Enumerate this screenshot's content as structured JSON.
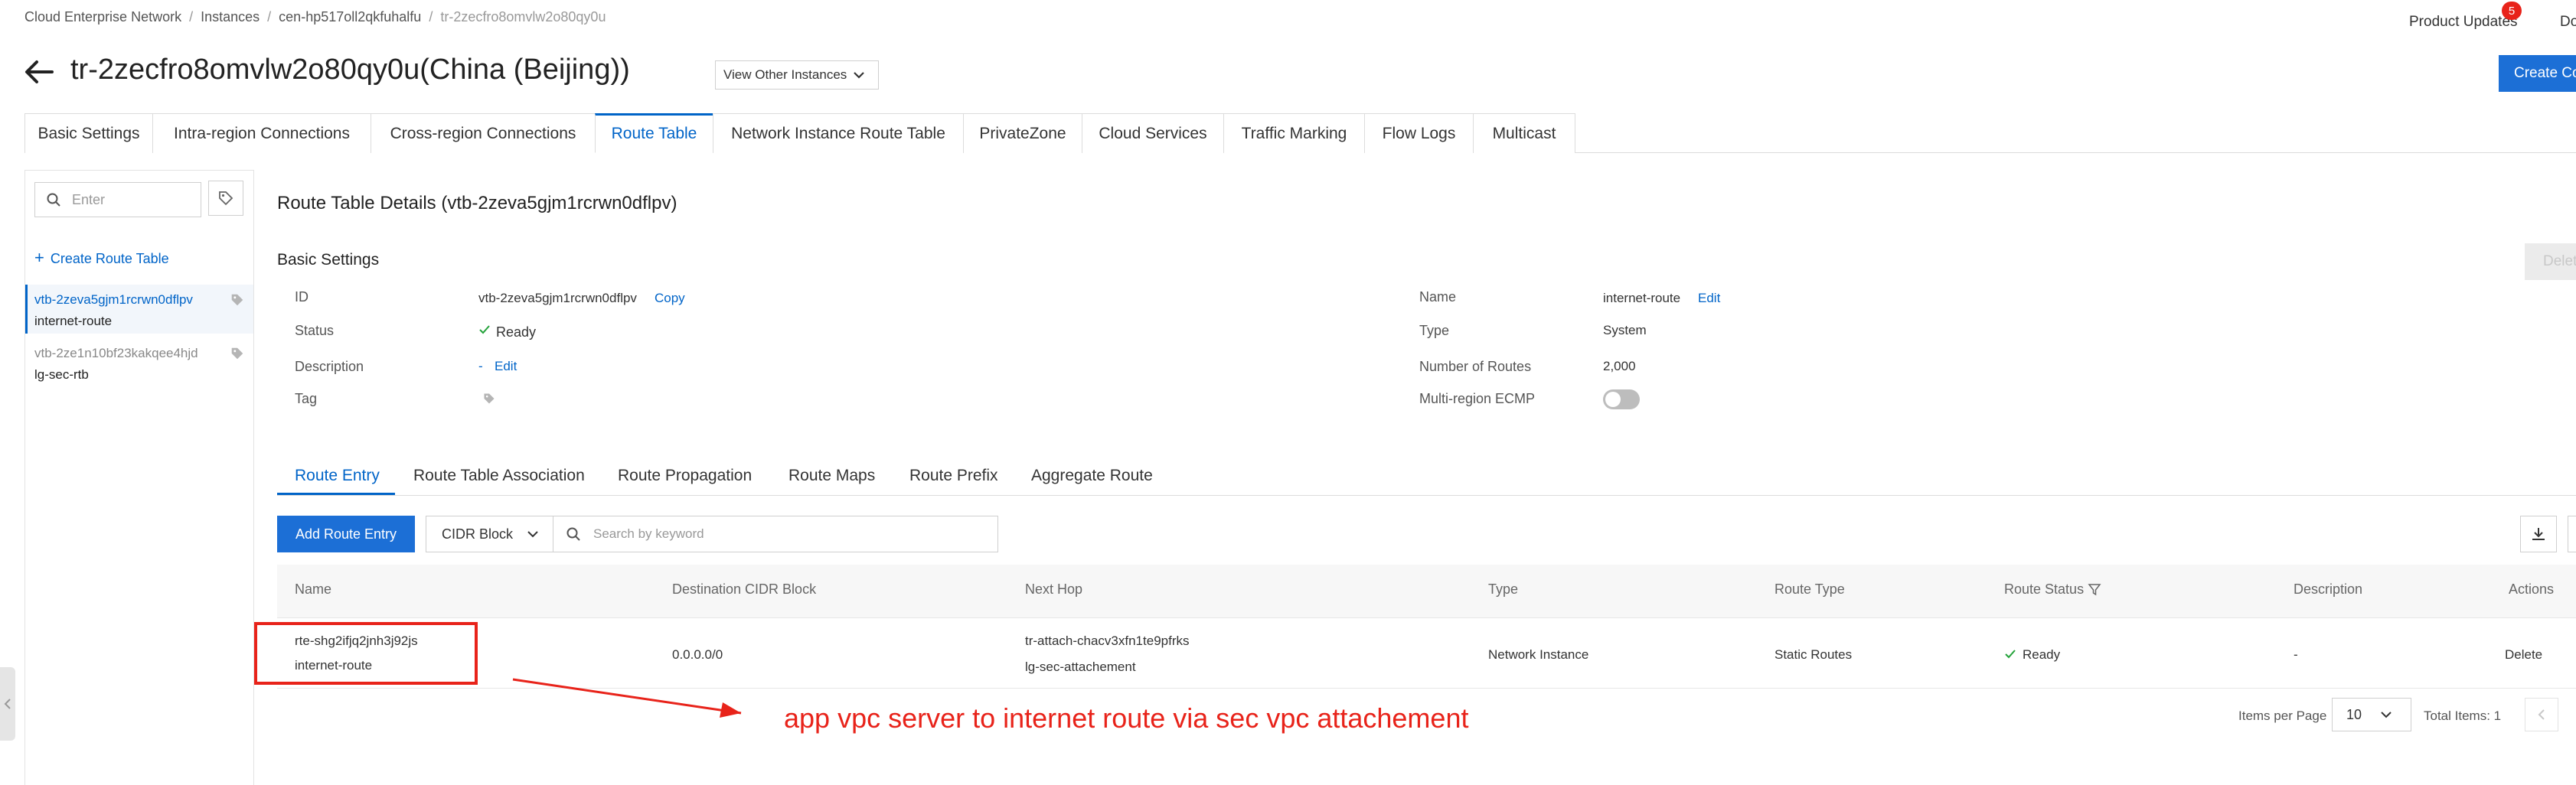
{
  "breadcrumb": [
    "Cloud Enterprise Network",
    "Instances",
    "cen-hp517oll2qkfuhalfu",
    "tr-2zecfro8omvlw2o80qy0u"
  ],
  "header": {
    "title": "tr-2zecfro8omvlw2o80qy0u(China (Beijing))",
    "view_other": "View Other Instances",
    "product_updates": "Product Updates",
    "updates_badge": "5",
    "docs_label": "Do",
    "create_button": "Create Co"
  },
  "tabs": [
    "Basic Settings",
    "Intra-region Connections",
    "Cross-region Connections",
    "Route Table",
    "Network Instance Route Table",
    "PrivateZone",
    "Cloud Services",
    "Traffic Marking",
    "Flow Logs",
    "Multicast"
  ],
  "sidebar": {
    "search_placeholder": "Enter",
    "create_label": "Create Route Table",
    "items": [
      {
        "id": "vtb-2zeva5gjm1rcrwn0dflpv",
        "name": "internet-route"
      },
      {
        "id": "vtb-2ze1n10bf23kakqee4hjd",
        "name": "lg-sec-rtb"
      }
    ]
  },
  "details": {
    "heading": "Route Table Details (vtb-2zeva5gjm1rcrwn0dflpv)",
    "basic_settings": "Basic Settings",
    "delete_button": "Delet",
    "id_label": "ID",
    "id_value": "vtb-2zeva5gjm1rcrwn0dflpv",
    "copy": "Copy",
    "status_label": "Status",
    "status_value": "Ready",
    "desc_label": "Description",
    "desc_value": "-",
    "desc_edit": "Edit",
    "tag_label": "Tag",
    "name_label": "Name",
    "name_value": "internet-route",
    "name_edit": "Edit",
    "type_label": "Type",
    "type_value": "System",
    "routes_label": "Number of Routes",
    "routes_value": "2,000",
    "ecmp_label": "Multi-region ECMP"
  },
  "subtabs": [
    "Route Entry",
    "Route Table Association",
    "Route Propagation",
    "Route Maps",
    "Route Prefix",
    "Aggregate Route"
  ],
  "toolbar": {
    "add_button": "Add Route Entry",
    "filter_select": "CIDR Block",
    "search_placeholder": "Search by keyword"
  },
  "table": {
    "headers": [
      "Name",
      "Destination CIDR Block",
      "Next Hop",
      "Type",
      "Route Type",
      "Route Status",
      "Description",
      "Actions"
    ],
    "row": {
      "name_id": "rte-shg2ifjq2jnh3j92js",
      "name": "internet-route",
      "cidr": "0.0.0.0/0",
      "next_hop_id": "tr-attach-chacv3xfn1te9pfrks",
      "next_hop_name": "lg-sec-attachement",
      "type": "Network Instance",
      "route_type": "Static Routes",
      "status": "Ready",
      "description": "-",
      "action": "Delete"
    }
  },
  "pagination": {
    "items_label": "Items per Page",
    "page_size": "10",
    "total": "Total Items: 1"
  },
  "annotation": {
    "text": "app vpc server to internet route via sec vpc attachement",
    "color": "#e8231a"
  },
  "colors": {
    "accent": "#0064c8",
    "annotation": "#e8231a",
    "success": "#23a23a"
  }
}
